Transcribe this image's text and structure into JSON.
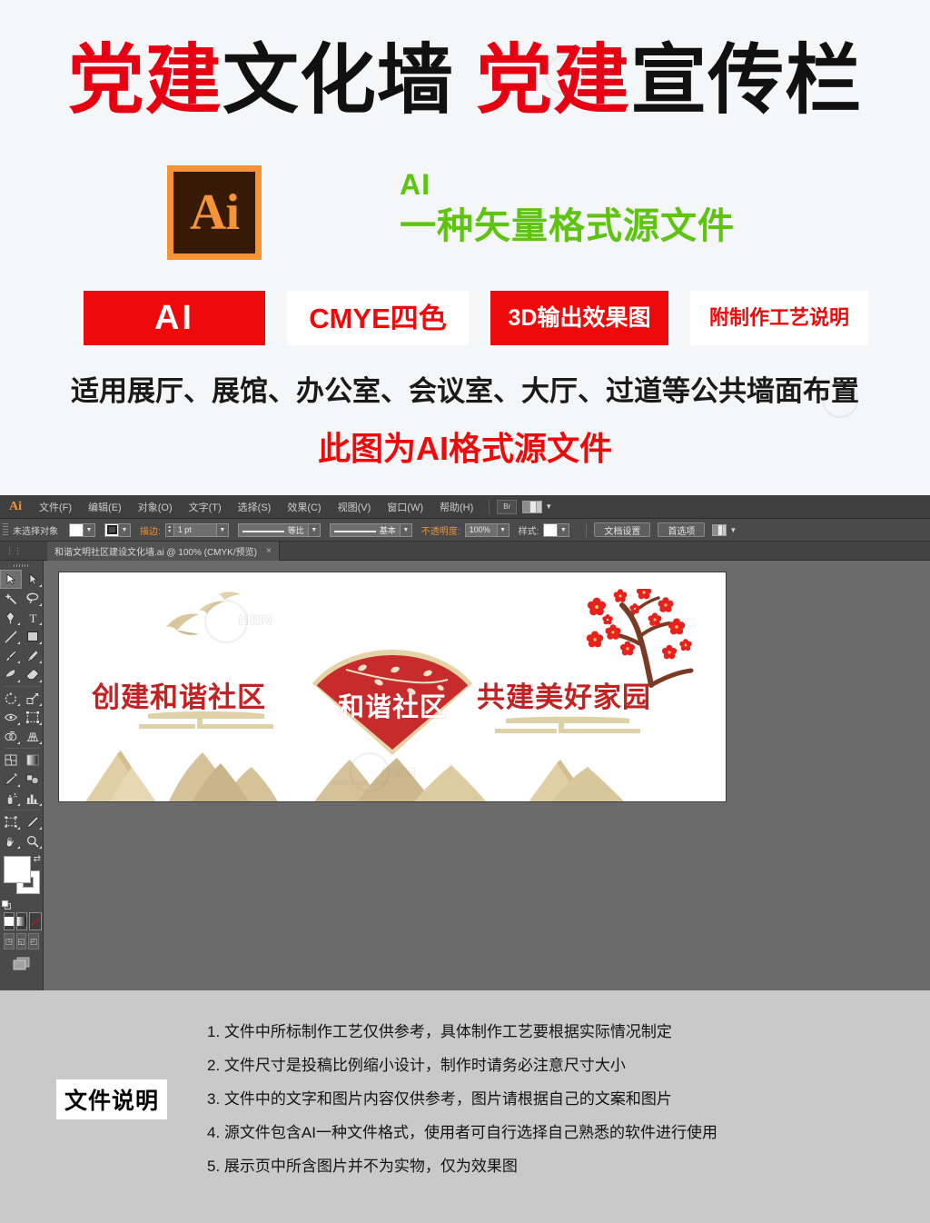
{
  "promo": {
    "title_parts": [
      {
        "text": "党建",
        "color": "#e60012"
      },
      {
        "text": "文化墙",
        "color": "#111111"
      },
      {
        "text": "  ",
        "color": "#111111"
      },
      {
        "text": "党建",
        "color": "#e60012"
      },
      {
        "text": "宣传栏",
        "color": "#111111"
      }
    ],
    "title_plain": "党建文化墙 党建宣传栏",
    "ai_logo_text": "Ai",
    "green_line1": "AI",
    "green_line2": "一种矢量格式源文件",
    "green_color": "#5ec410",
    "badges": [
      {
        "label": "AI",
        "style": "red"
      },
      {
        "label": "CMYE四色",
        "style": "white"
      },
      {
        "label": "3D输出效果图",
        "style": "red"
      },
      {
        "label": "附制作工艺说明",
        "style": "white"
      }
    ],
    "subtitle": "适用展厅、展馆、办公室、会议室、大厅、过道等公共墙面布置",
    "note": "此图为AI格式源文件",
    "note_color": "#ee0a0a"
  },
  "ai_app": {
    "app_logo": "Ai",
    "menus": [
      "文件(F)",
      "编辑(E)",
      "对象(O)",
      "文字(T)",
      "选择(S)",
      "效果(C)",
      "视图(V)",
      "窗口(W)",
      "帮助(H)"
    ],
    "bridge_button": "Br",
    "control_bar": {
      "selection_status": "未选择对象",
      "stroke_label": "描边:",
      "stroke_weight": "1 pt",
      "profile": "等比",
      "brush": "基本",
      "opacity_label": "不透明度:",
      "opacity_value": "100%",
      "style_label": "样式:",
      "doc_setup_button": "文档设置",
      "preferences_button": "首选项"
    },
    "document_tab": {
      "title": "和谐文明社区建设文化墙.ai @ 100% (CMYK/预览)",
      "close": "×"
    },
    "toolbar_tools": [
      "selection-tool",
      "direct-selection-tool",
      "magic-wand-tool",
      "lasso-tool",
      "pen-tool",
      "type-tool",
      "line-segment-tool",
      "rectangle-tool",
      "paintbrush-tool",
      "pencil-tool",
      "blob-brush-tool",
      "eraser-tool",
      "rotate-tool",
      "scale-tool",
      "width-tool",
      "free-transform-tool",
      "shape-builder-tool",
      "perspective-grid-tool",
      "mesh-tool",
      "gradient-tool",
      "eyedropper-tool",
      "blend-tool",
      "symbol-sprayer-tool",
      "column-graph-tool",
      "artboard-tool",
      "slice-tool",
      "hand-tool",
      "zoom-tool"
    ],
    "color_controls": {
      "fill": "#ffffff",
      "stroke": "#ffffff",
      "modes": [
        "solid-color",
        "gradient",
        "none"
      ],
      "draw_modes": [
        "draw-normal",
        "draw-behind",
        "draw-inside"
      ],
      "screen_mode": "change-screen-mode"
    },
    "artwork": {
      "left_text": "创建和谐社区",
      "fan_text": "和谐社区",
      "right_text": "共建美好家园",
      "red": "#c32222",
      "fan_red": "#c72b2b",
      "fan_gold": "#e6d4a6",
      "mountain_tan": "#d9c89d"
    },
    "watermarks": [
      "创图网",
      "www.ctupic.com"
    ]
  },
  "notes": {
    "label": "文件说明",
    "items": [
      "1. 文件中所标制作工艺仅供参考，具体制作工艺要根据实际情况制定",
      "2. 文件尺寸是投稿比例缩小设计，制作时请务必注意尺寸大小",
      "3. 文件中的文字和图片内容仅供参考，图片请根据自己的文案和图片",
      "4. 源文件包含AI一种文件格式，使用者可自行选择自己熟悉的软件进行使用",
      "5. 展示页中所含图片并不为实物，仅为效果图"
    ]
  }
}
